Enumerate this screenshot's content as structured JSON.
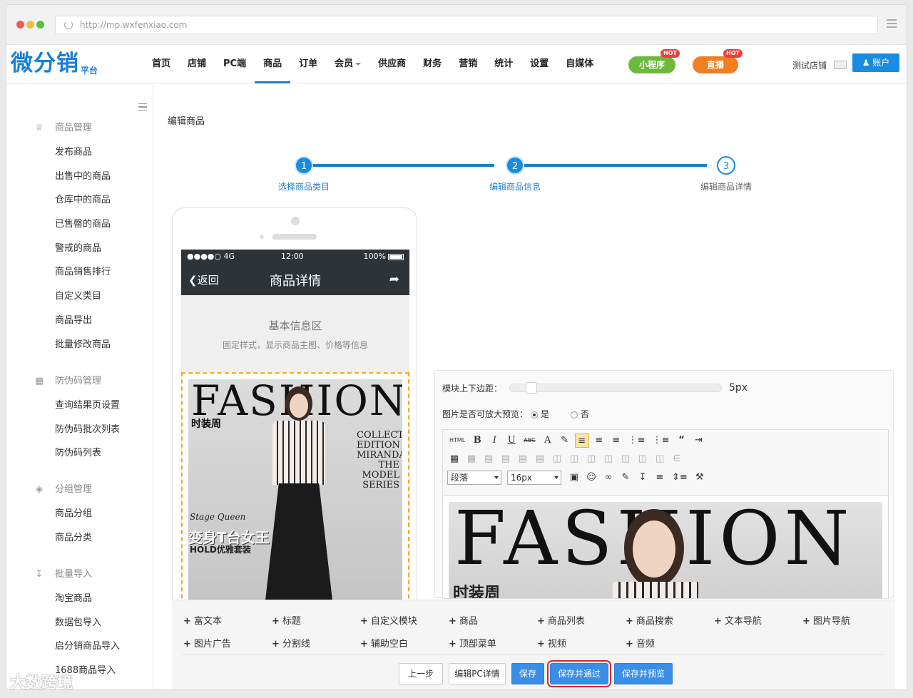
{
  "browser": {
    "url": "http://mp.wxfenxiao.com"
  },
  "header": {
    "logo_text": "微分销",
    "logo_sub": "平台",
    "nav": [
      {
        "label": "首页"
      },
      {
        "label": "店铺"
      },
      {
        "label": "PC端"
      },
      {
        "label": "商品",
        "active": true
      },
      {
        "label": "订单"
      },
      {
        "label": "会员"
      },
      {
        "label": "供应商"
      },
      {
        "label": "财务"
      },
      {
        "label": "营销"
      },
      {
        "label": "统计"
      },
      {
        "label": "设置"
      },
      {
        "label": "自媒体"
      }
    ],
    "miniprogram_label": "小程序",
    "live_label": "直播",
    "hot_badge": "HOT",
    "shop_name": "测试店铺",
    "account_label": "账户",
    "colors": {
      "primary": "#1a7fd4",
      "green_pill": "#6cb93c",
      "orange_pill": "#f37d21",
      "hot": "#e8413c"
    }
  },
  "sidebar": {
    "sections": [
      {
        "title": "商品管理",
        "icon": "crown-icon",
        "items": [
          "发布商品",
          "出售中的商品",
          "仓库中的商品",
          "已售罄的商品",
          "警戒的商品",
          "商品销售排行",
          "自定义类目",
          "商品导出",
          "批量修改商品"
        ]
      },
      {
        "title": "防伪码管理",
        "icon": "qrcode-icon",
        "items": [
          "查询结果页设置",
          "防伪码批次列表",
          "防伪码列表"
        ]
      },
      {
        "title": "分组管理",
        "icon": "tag-icon",
        "items": [
          "商品分组",
          "商品分类"
        ]
      },
      {
        "title": "批量导入",
        "icon": "import-icon",
        "items": [
          "淘宝商品",
          "数据包导入",
          "启分销商品导入",
          "1688商品导入"
        ]
      }
    ]
  },
  "main": {
    "page_title": "编辑商品",
    "steps": [
      {
        "num": "1",
        "label": "选择商品类目"
      },
      {
        "num": "2",
        "label": "编辑商品信息"
      },
      {
        "num": "3",
        "label": "编辑商品详情"
      }
    ],
    "phone": {
      "signal": "●●●●○ 4G",
      "time": "12:00",
      "battery": "100%",
      "back_label": "返回",
      "title": "商品详情",
      "basic_title": "基本信息区",
      "basic_desc": "固定样式，显示商品主图、价格等信息",
      "poster": {
        "big": "FASHION",
        "sub": "时装周",
        "right_text": "COLLECTOR EDITION MIRANDA THE MODEL SERIES",
        "script": "Stage Queen",
        "cn_big": "变身T台女王",
        "cn_hold": "HOLD优雅套装"
      }
    },
    "editor": {
      "margin_label": "模块上下边距：",
      "margin_value": "5px",
      "zoom_label": "图片是否可放大预览：",
      "yes": "是",
      "no": "否",
      "toolbar": {
        "html": "HTML",
        "bold": "B",
        "italic": "I",
        "underline": "U",
        "strike": "ABC",
        "font_color": "A",
        "paragraph": "段落",
        "font_size": "16px"
      },
      "image": {
        "big": "FASHION",
        "sub": "时装周"
      }
    },
    "modules": {
      "row1": [
        "富文本",
        "标题",
        "自定义模块",
        "商品",
        "商品列表",
        "商品搜索",
        "文本导航",
        "图片导航"
      ],
      "row2": [
        "图片广告",
        "分割线",
        "辅助空白",
        "顶部菜单",
        "视频",
        "音频"
      ]
    },
    "buttons": {
      "prev": "上一步",
      "edit_pc": "编辑PC详情",
      "save": "保存",
      "save_approve": "保存并通过",
      "save_preview": "保存并预览"
    }
  },
  "watermark": "大数跨境"
}
